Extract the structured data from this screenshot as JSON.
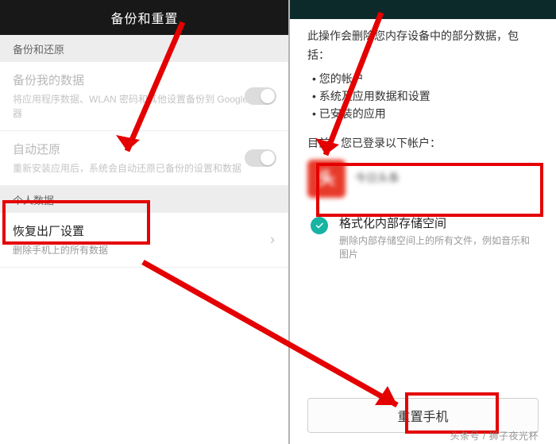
{
  "left": {
    "title": "备份和重置",
    "section_backup": "备份和还原",
    "row_backup": {
      "title": "备份我的数据",
      "subtitle": "将应用程序数据、WLAN 密码和其他设置备份到 Google 服务器"
    },
    "row_autorestore": {
      "title": "自动还原",
      "subtitle": "重新安装应用后，系统会自动还原已备份的设置和数据"
    },
    "section_personal": "个人数据",
    "row_factory": {
      "title": "恢复出厂设置",
      "subtitle": "删除手机上的所有数据"
    }
  },
  "right": {
    "intro": "此操作会删除您内存设备中的部分数据，包括：",
    "bullets": [
      "您的帐户",
      "系统及应用数据和设置",
      "已安装的应用"
    ],
    "logged_in_label": "目前，您已登录以下帐户：",
    "account_name": "今日头条",
    "format": {
      "title": "格式化内部存储空间",
      "subtitle": "删除内部存储空间上的所有文件，例如音乐和图片"
    },
    "reset_button": "重置手机"
  },
  "watermark": "头条号 / 狮子夜光杯"
}
